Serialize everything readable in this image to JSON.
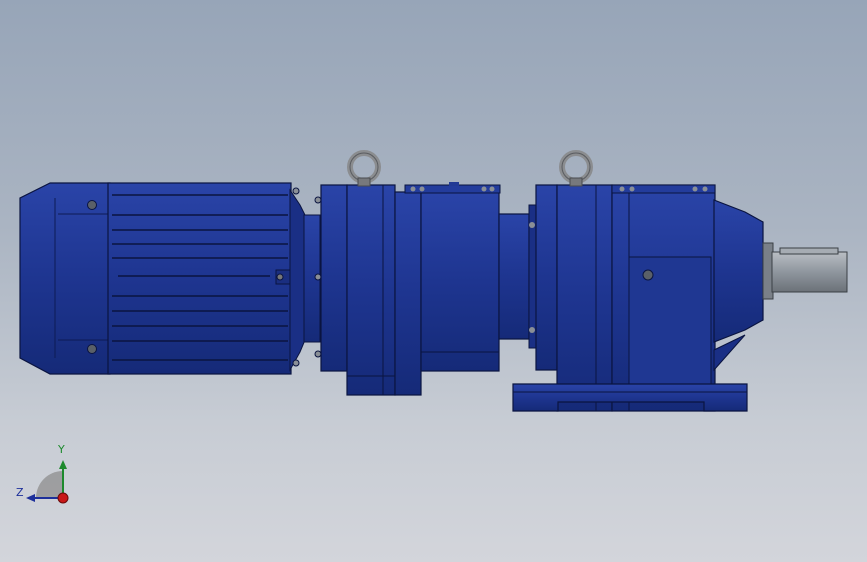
{
  "viewport": {
    "background_top": "#97a5b8",
    "background_bottom": "#d3d5db"
  },
  "model": {
    "description_icon": "geared-motor-model",
    "colors": {
      "body": "#1e3590",
      "body_dark": "#122366",
      "body_light": "#3550b8",
      "outline": "#0a1440",
      "shaft": "#8f969e",
      "lifting_eye": "#8b8d90"
    }
  },
  "triad": {
    "y_label": "Y",
    "z_label": "Z",
    "y_color": "#1d8a2d",
    "z_color": "#1d2f9a",
    "x_color": "#c81818"
  }
}
